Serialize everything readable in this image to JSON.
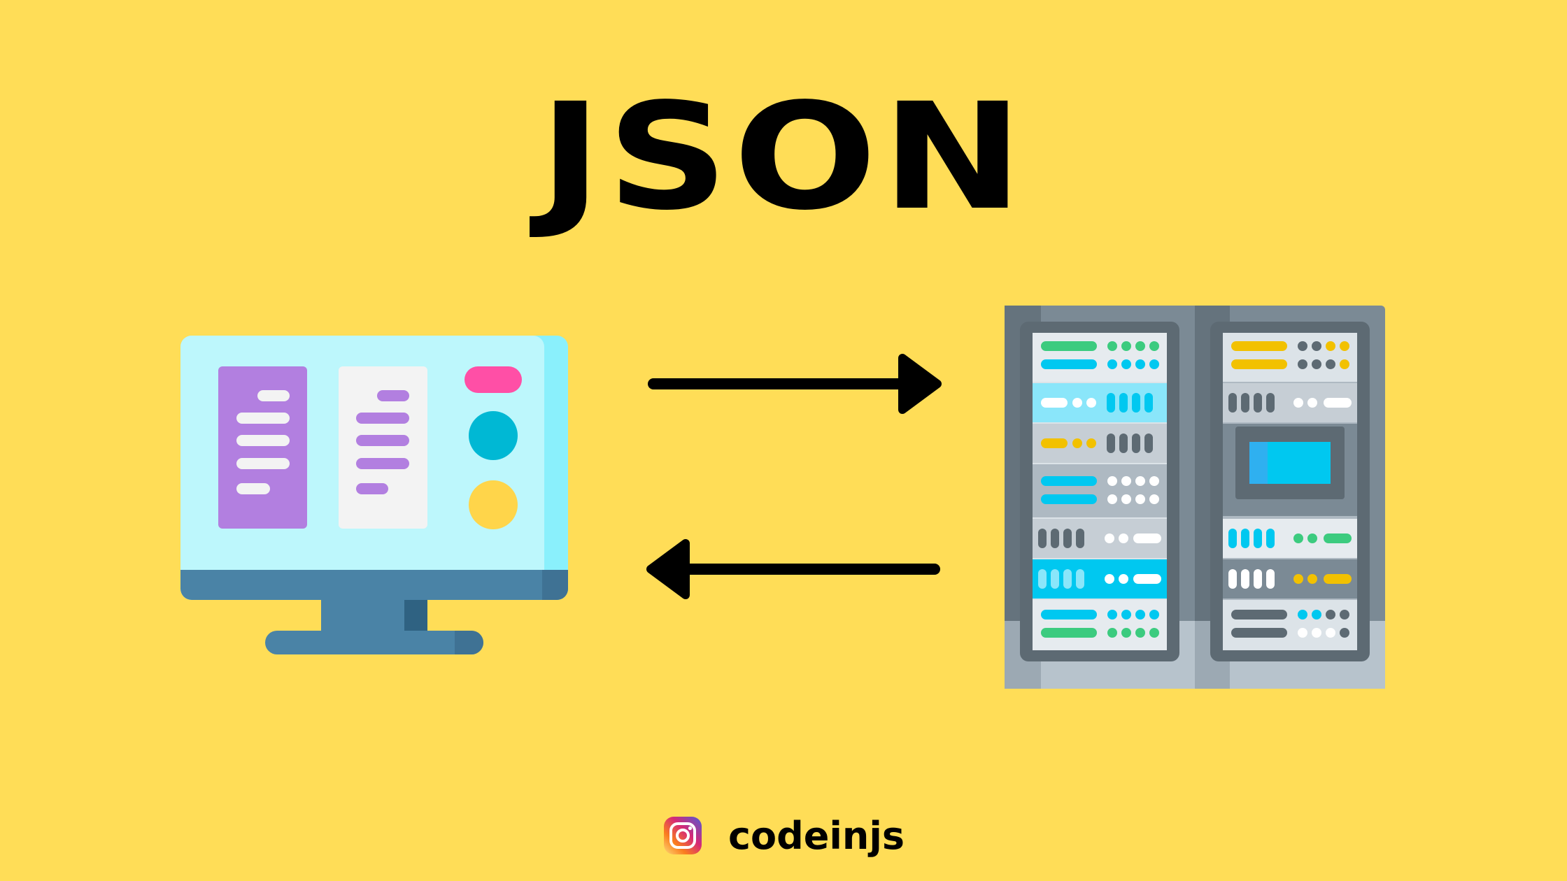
{
  "title": "JSON",
  "footer": {
    "handle": "codeinjs"
  },
  "icons": {
    "client": "computer-monitor-icon",
    "server": "server-rack-icon",
    "request": "arrow-right-icon",
    "response": "arrow-left-icon",
    "social": "instagram-icon"
  },
  "colors": {
    "background": "#FFDD57",
    "text": "#000000",
    "monitor_screen": "#BDF7FC",
    "monitor_frame": "#4A83A6",
    "accent_purple": "#B27FE0",
    "accent_pink": "#FF4FA6",
    "accent_cyan": "#00B8D4",
    "accent_yellow": "#FFD54A",
    "server_body": "#7B8A95",
    "server_frame": "#5D6A73",
    "led_green": "#3CCB7F",
    "led_blue": "#00C8F0",
    "led_amber": "#F2C100"
  }
}
